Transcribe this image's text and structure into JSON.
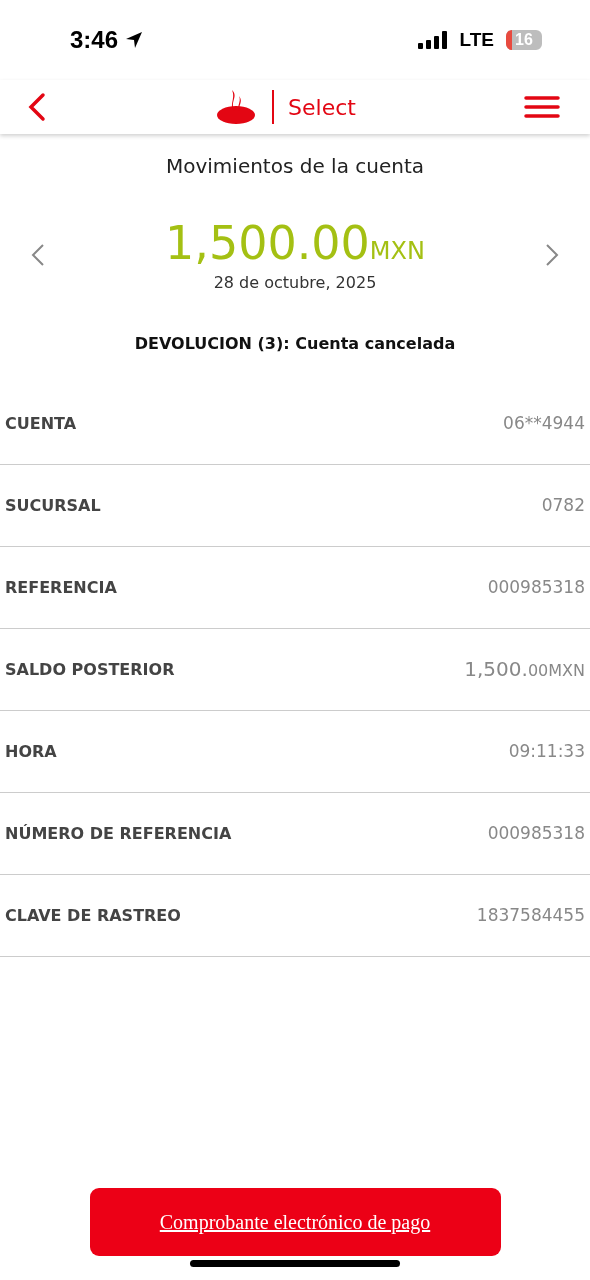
{
  "status_bar": {
    "time": "3:46",
    "network": "LTE",
    "battery": "16"
  },
  "header": {
    "brand": "Select"
  },
  "title": "Movimientos de la cuenta",
  "movement": {
    "amount": "1,500.00",
    "currency": "MXN",
    "date": "28 de octubre, 2025",
    "description": "DEVOLUCION (3): Cuenta cancelada"
  },
  "details": [
    {
      "kind": "text",
      "label": "CUENTA",
      "value": "06**4944"
    },
    {
      "kind": "text",
      "label": "SUCURSAL",
      "value": "0782"
    },
    {
      "kind": "text",
      "label": "REFERENCIA",
      "value": "000985318"
    },
    {
      "kind": "amount",
      "label": "SALDO POSTERIOR",
      "amount": "1,500.",
      "cents": "00",
      "currency": "MXN"
    },
    {
      "kind": "text",
      "label": "HORA",
      "value": "09:11:33"
    },
    {
      "kind": "text",
      "label": "NÚMERO DE REFERENCIA",
      "value": "000985318"
    },
    {
      "kind": "text",
      "label": "CLAVE DE RASTREO",
      "value": "1837584455"
    }
  ],
  "button": "Comprobante electrónico de pago"
}
